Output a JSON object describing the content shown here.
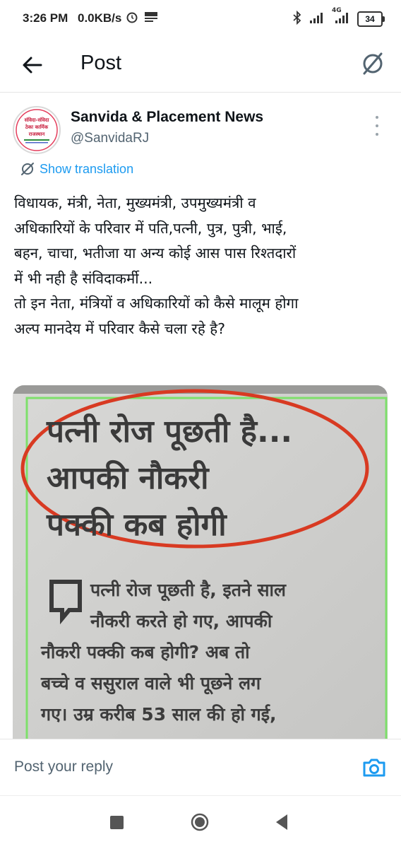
{
  "status_bar": {
    "time": "3:26 PM",
    "speed": "0.0KB/s",
    "battery": "34",
    "network": "4G",
    "icons": [
      "alarm-icon",
      "news-app-icon",
      "bluetooth-icon",
      "signal-icon",
      "signal-4g-icon",
      "battery-icon"
    ]
  },
  "app_bar": {
    "title": "Post",
    "back_icon": "arrow-left-icon",
    "translate_icon": "translate-off-icon"
  },
  "post": {
    "author_name": "Sanvida & Placement News",
    "author_handle": "@SanvidaRJ",
    "avatar_lines": [
      "संविदा-संविदा",
      "ठेका कार्मिक",
      "राजस्थान"
    ],
    "show_translation": "Show translation",
    "text": "विधायक, मंत्री, नेता, मुख्यमंत्री, उपमुख्यमंत्री व\nअधिकारियों के परिवार में पति,पत्नी, पुत्र, पुत्री, भाई,\nबहन, चाचा, भतीजा या अन्य कोई आस पास रिश्तदारों\nमें भी नही है संविदाकर्मी...\nतो इन नेता, मंत्रियों व अधिकारियों को कैसे मालूम होगा\nअल्प मानदेय में परिवार कैसे चला रहे है?",
    "media": {
      "headline_lines": [
        "पत्नी रोज पूछती है...",
        "आपकी नौकरी",
        "पक्की कब होगी"
      ],
      "body_lines": [
        "पत्नी रोज पूछती है, इतने साल",
        "नौकरी करते हो गए, आपकी",
        "नौकरी पक्की कब होगी? अब तो",
        "बच्चे व ससुराल वाले भी पूछने लग",
        "गए। उम्र करीब 53 साल की हो गई,"
      ]
    }
  },
  "reply": {
    "placeholder": "Post your reply",
    "camera_icon": "camera-icon"
  },
  "nav": {
    "icons": [
      "recents-square-icon",
      "home-circle-icon",
      "back-triangle-icon"
    ]
  },
  "colors": {
    "accent": "#1d9bf0",
    "text": "#0f1419",
    "secondary": "#536471",
    "circle_red": "#d83a22",
    "clipping_border": "#7ee06b"
  }
}
